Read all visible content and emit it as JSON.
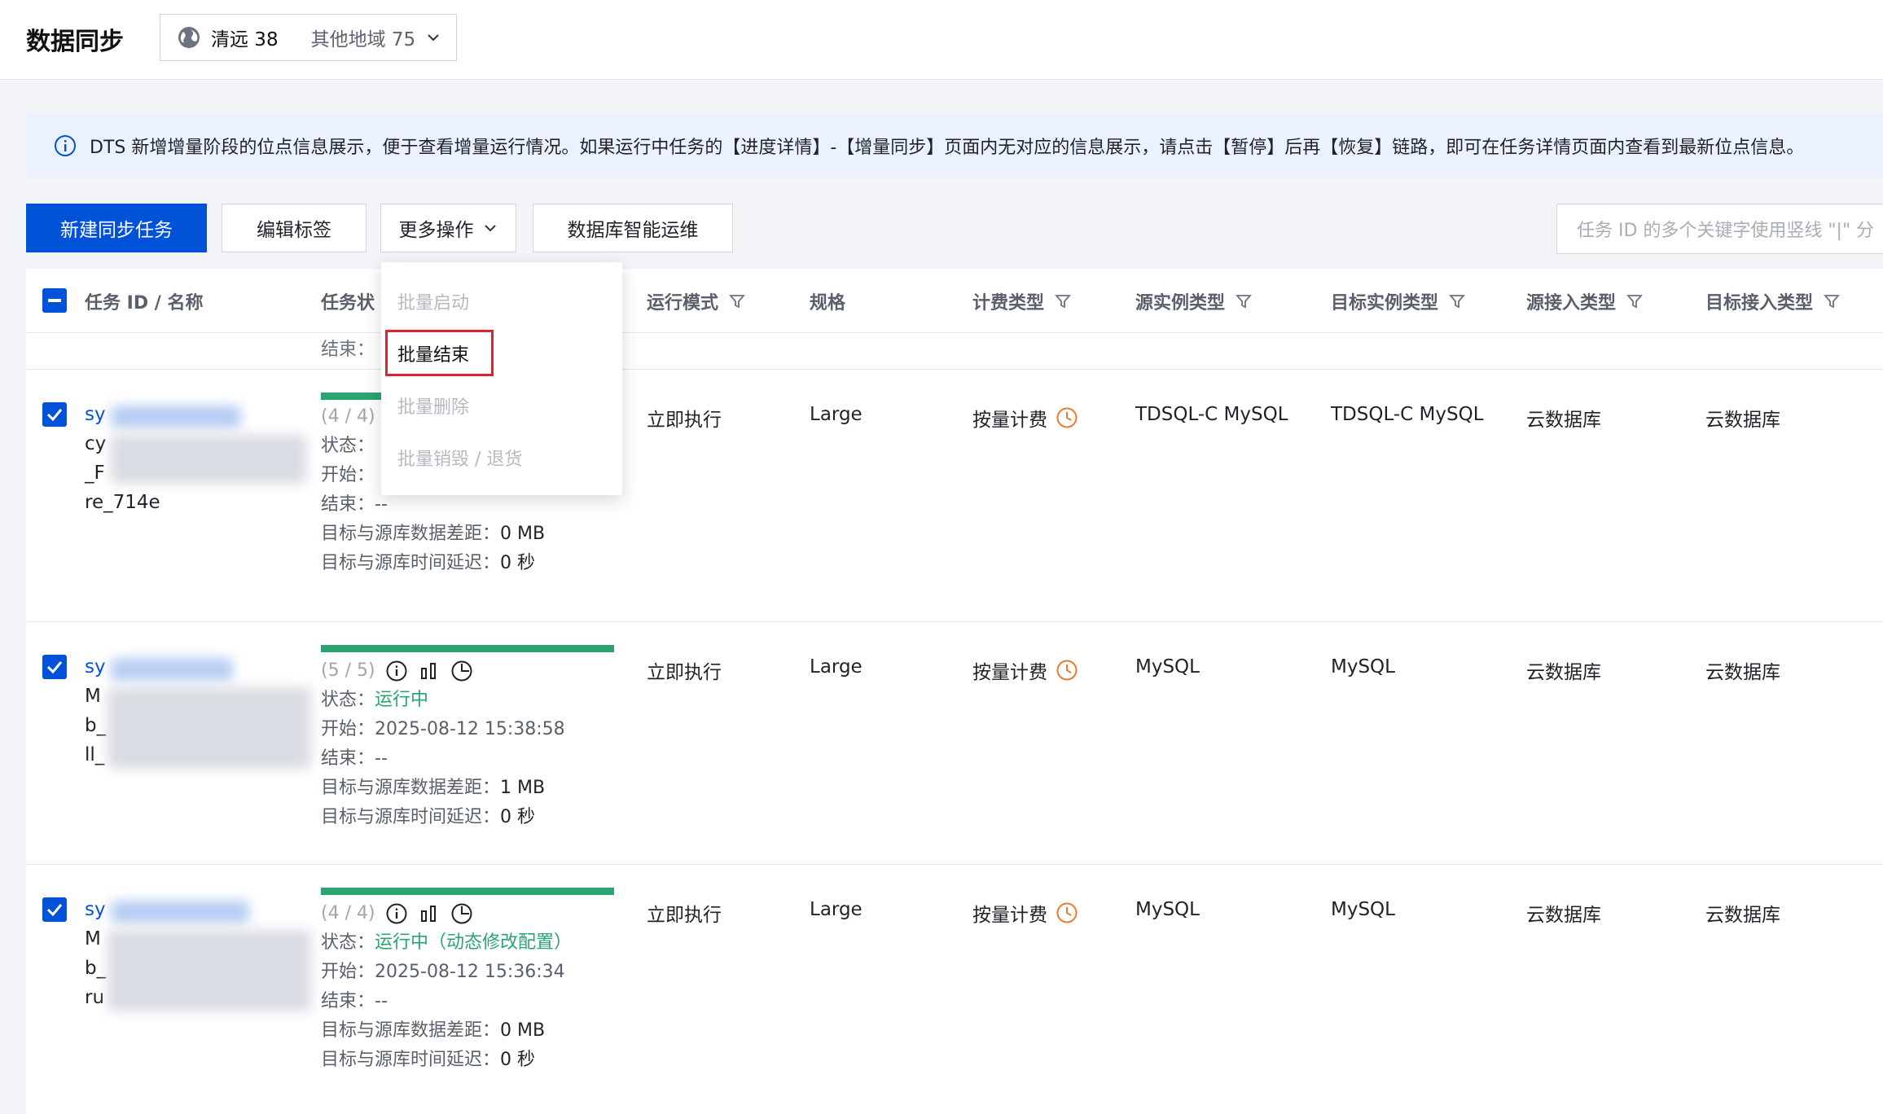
{
  "header": {
    "title": "数据同步",
    "region_current": "清远 38",
    "region_other": "其他地域 75"
  },
  "notice": {
    "text": "DTS 新增增量阶段的位点信息展示，便于查看增量运行情况。如果运行中任务的【进度详情】-【增量同步】页面内无对应的信息展示，请点击【暂停】后再【恢复】链路，即可在任务详情页面内查看到最新位点信息。"
  },
  "toolbar": {
    "create_label": "新建同步任务",
    "edit_tags_label": "编辑标签",
    "more_ops_label": "更多操作",
    "db_ops_label": "数据库智能运维",
    "search_placeholder": "任务 ID 的多个关键字使用竖线 \"|\" 分"
  },
  "dropdown": {
    "items": [
      "批量启动",
      "批量结束",
      "批量删除",
      "批量销毁 / 退货"
    ],
    "selected": "批量结束"
  },
  "table": {
    "headers": {
      "id_name": "任务 ID / 名称",
      "status": "任务状",
      "run_mode": "运行模式",
      "spec": "规格",
      "billing": "计费类型",
      "src_type": "源实例类型",
      "dst_type": "目标实例类型",
      "src_access": "源接入类型",
      "dst_access": "目标接入类型"
    },
    "partial_row_text": "结束：",
    "labels": {
      "state": "状态：",
      "start": "开始：",
      "end": "结束：",
      "diff": "目标与源库数据差距：",
      "delay": "目标与源库时间延迟："
    },
    "rows": [
      {
        "id_prefix": "sy",
        "name_lines": [
          "cy",
          "_F",
          "re_714e"
        ],
        "steps": "(4 / 4)",
        "state": "",
        "start": "",
        "end": "--",
        "diff": "0 MB",
        "delay": "0 秒",
        "run_mode": "立即执行",
        "spec": "Large",
        "billing": "按量计费",
        "src_type": "TDSQL-C MySQL",
        "dst_type": "TDSQL-C MySQL",
        "src_access": "云数据库",
        "dst_access": "云数据库"
      },
      {
        "id_prefix": "sy",
        "name_lines": [
          "M",
          "b_",
          "ll_"
        ],
        "steps": "(5 / 5)",
        "state": "运行中",
        "start": "2025-08-12 15:38:58",
        "end": "--",
        "diff": "1 MB",
        "delay": "0 秒",
        "run_mode": "立即执行",
        "spec": "Large",
        "billing": "按量计费",
        "src_type": "MySQL",
        "dst_type": "MySQL",
        "src_access": "云数据库",
        "dst_access": "云数据库"
      },
      {
        "id_prefix": "sy",
        "name_lines": [
          "M",
          "b_",
          "ru"
        ],
        "steps": "(4 / 4)",
        "state": "运行中（动态修改配置）",
        "start": "2025-08-12 15:36:34",
        "end": "--",
        "diff": "0 MB",
        "delay": "0 秒",
        "run_mode": "立即执行",
        "spec": "Large",
        "billing": "按量计费",
        "src_type": "MySQL",
        "dst_type": "MySQL",
        "src_access": "云数据库",
        "dst_access": "云数据库"
      }
    ]
  },
  "colors": {
    "primary": "#0052d9",
    "success": "#2ba471",
    "warning": "#ed7b2f",
    "highlight": "#e0222d"
  }
}
